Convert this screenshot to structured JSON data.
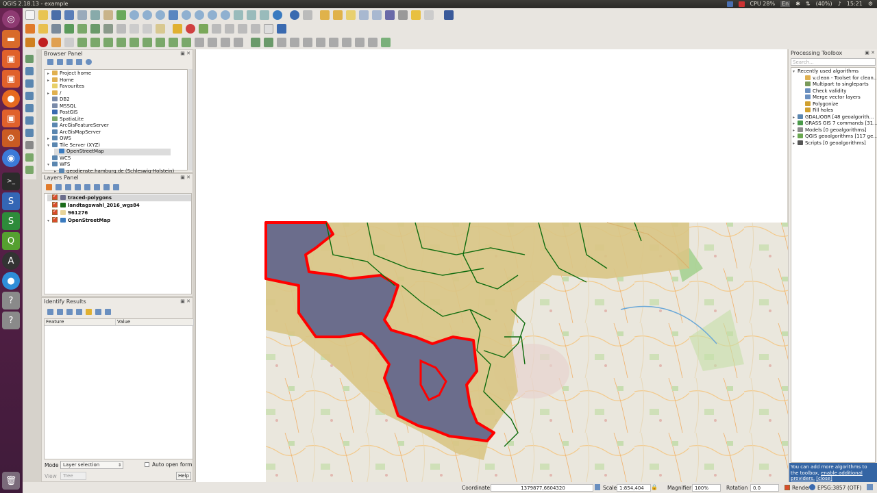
{
  "window": {
    "title": "QGIS 2.18.13 - example"
  },
  "tray": {
    "cpu": "CPU 28%",
    "keyboard": "En",
    "battery": "(40%)",
    "clock": "15:21"
  },
  "browser_panel": {
    "title": "Browser Panel",
    "items": [
      {
        "label": "Project home",
        "arrow": "▸",
        "icon": "folder-icon",
        "indent": 0
      },
      {
        "label": "Home",
        "arrow": "▸",
        "icon": "folder-icon",
        "indent": 0
      },
      {
        "label": "Favourites",
        "arrow": "",
        "icon": "star-icon",
        "indent": 0
      },
      {
        "label": "/",
        "arrow": "▸",
        "icon": "folder-icon",
        "indent": 0
      },
      {
        "label": "DB2",
        "arrow": "",
        "icon": "database-icon",
        "indent": 0
      },
      {
        "label": "MSSQL",
        "arrow": "",
        "icon": "database-icon",
        "indent": 0
      },
      {
        "label": "PostGIS",
        "arrow": "",
        "icon": "elephant-icon",
        "indent": 0
      },
      {
        "label": "SpatiaLite",
        "arrow": "",
        "icon": "feather-icon",
        "indent": 0
      },
      {
        "label": "ArcGisFeatureServer",
        "arrow": "",
        "icon": "globe-icon",
        "indent": 0
      },
      {
        "label": "ArcGisMapServer",
        "arrow": "",
        "icon": "globe-icon",
        "indent": 0
      },
      {
        "label": "OWS",
        "arrow": "▸",
        "icon": "globe-icon",
        "indent": 0
      },
      {
        "label": "Tile Server (XYZ)",
        "arrow": "▾",
        "icon": "globe-icon",
        "indent": 0
      },
      {
        "label": "OpenStreetMap",
        "arrow": "",
        "icon": "tile-icon",
        "indent": 1
      },
      {
        "label": "WCS",
        "arrow": "",
        "icon": "globe-icon",
        "indent": 0
      },
      {
        "label": "WFS",
        "arrow": "▾",
        "icon": "globe-icon",
        "indent": 0
      },
      {
        "label": "geodienste.hamburg.de (Schleswig-Holstein)",
        "arrow": "▸",
        "icon": "globe-icon",
        "indent": 1
      }
    ]
  },
  "layers_panel": {
    "title": "Layers Panel",
    "layers": [
      {
        "label": "traced-polygons",
        "icon_color": "#6b6d8c"
      },
      {
        "label": "landtagswahl_2016_wgs84",
        "icon_color": "#1a6b1a"
      },
      {
        "label": "961276",
        "icon_color": "#e8d49a"
      },
      {
        "label": "OpenStreetMap",
        "icon_color": "#3b7bbf"
      }
    ]
  },
  "identify_panel": {
    "title": "Identify Results",
    "col_feature": "Feature",
    "col_value": "Value",
    "mode_label": "Mode",
    "mode_value": "Layer selection",
    "auto_open": "Auto open form",
    "view_label": "View",
    "view_value": "Tree",
    "help": "Help"
  },
  "processing": {
    "title": "Processing Toolbox",
    "search_placeholder": "Search...",
    "recent_label": "Recently used algorithms",
    "recent": [
      "v.clean - Toolset for clean...",
      "Multipart to singleparts",
      "Check validity",
      "Merge vector layers",
      "Polygonize",
      "Fill holes"
    ],
    "providers": [
      "GDAL/OGR [48 geoalgorith...",
      "GRASS GIS 7 commands [31...",
      "Models [0 geoalgorithms]",
      "QGIS geoalgorithms [117 ge...",
      "Scripts [0 geoalgorithms]"
    ],
    "message_text": "You can add more algorithms to the toolbox,",
    "message_link": "enable additional providers.",
    "message_close": "[close]"
  },
  "status": {
    "coord_label": "Coordinate",
    "coord_value": "1379877,6604320",
    "scale_label": "Scale",
    "scale_value": "1:854,404",
    "magnifier_label": "Magnifier",
    "magnifier_value": "100%",
    "rotation_label": "Rotation",
    "rotation_value": "0.0",
    "render_label": "Render",
    "crs": "EPSG:3857 (OTF)"
  },
  "colors": {
    "selection_red": "#ff0000",
    "traced_fill": "#6b6d8c",
    "district_fill": "#d9c585",
    "boundary_green": "#0d6b0d"
  }
}
